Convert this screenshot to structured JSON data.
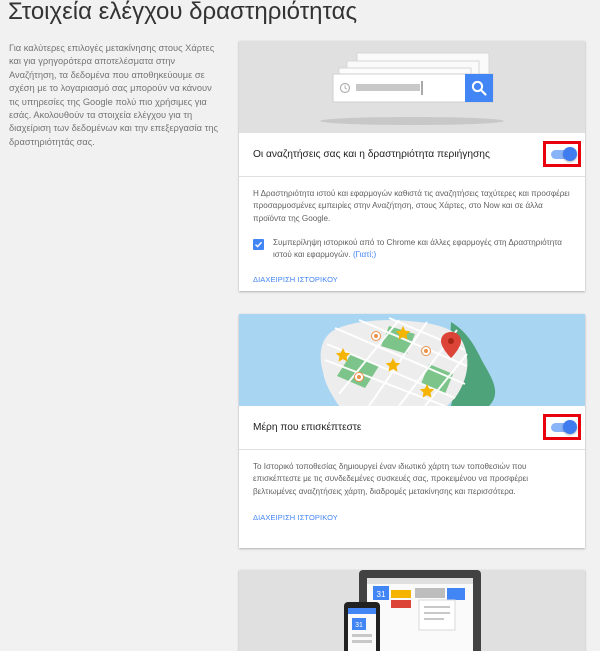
{
  "page": {
    "title": "Στοιχεία ελέγχου δραστηριότητας",
    "intro": "Για καλύτερες επιλογές μετακίνησης στους Χάρτες και για γρηγορότερα αποτελέσματα στην Αναζήτηση, τα δεδομένα που αποθηκεύουμε σε σχέση με το λογαριασμό σας μπορούν να κάνουν τις υπηρεσίες της Google πολύ πιο χρήσιμες για εσάς. Ακολουθούν τα στοιχεία ελέγχου για τη διαχείριση των δεδομένων και την επεξεργασία της δραστηριότητάς σας."
  },
  "web_activity": {
    "title": "Οι αναζητήσεις σας και η δραστηριότητα περιήγησης",
    "enabled": true,
    "description": "Η Δραστηριότητα ιστού και εφαρμογών καθιστά τις αναζητήσεις ταχύτερες και προσφέρει προσαρμοσμένες εμπειρίες στην Αναζήτηση, στους Χάρτες, στο Now και σε άλλα προϊόντα της Google.",
    "checkbox_label": "Συμπερίληψη ιστορικού από το Chrome και άλλες εφαρμογές στη Δραστηριότητα ιστού και εφαρμογών.",
    "why_link": "(Γιατί;)",
    "checked": true,
    "manage_link": "ΔΙΑΧΕΙΡΙΣΗ ΙΣΤΟΡΙΚΟΥ"
  },
  "location": {
    "title": "Μέρη που επισκέπτεστε",
    "enabled": true,
    "description": "Το Ιστορικό τοποθεσίας δημιουργεί έναν ιδιωτικό χάρτη των τοποθεσιών που επισκέπτεστε με τις συνδεδεμένες συσκευές σας, προκειμένου να προσφέρει βελτιωμένες αναζητήσεις χάρτη, διαδρομές μετακίνησης και περισσότερα.",
    "manage_link": "ΔΙΑΧΕΙΡΙΣΗ ΙΣΤΟΡΙΚΟΥ"
  },
  "devices_illustration": {
    "calendar_day": "31"
  },
  "colors": {
    "accent": "#4285f4",
    "toggle_outline": "#e8000c",
    "map_water": "#a8d5f2",
    "map_land": "#ededed",
    "map_park": "#7cc48a",
    "star": "#f4b400",
    "pin": "#db4437"
  },
  "icons": {
    "search_button": "search-icon",
    "history": "clock-icon",
    "pin": "map-pin-icon",
    "star": "star-icon",
    "check": "check-icon",
    "calendar": "calendar-icon"
  }
}
